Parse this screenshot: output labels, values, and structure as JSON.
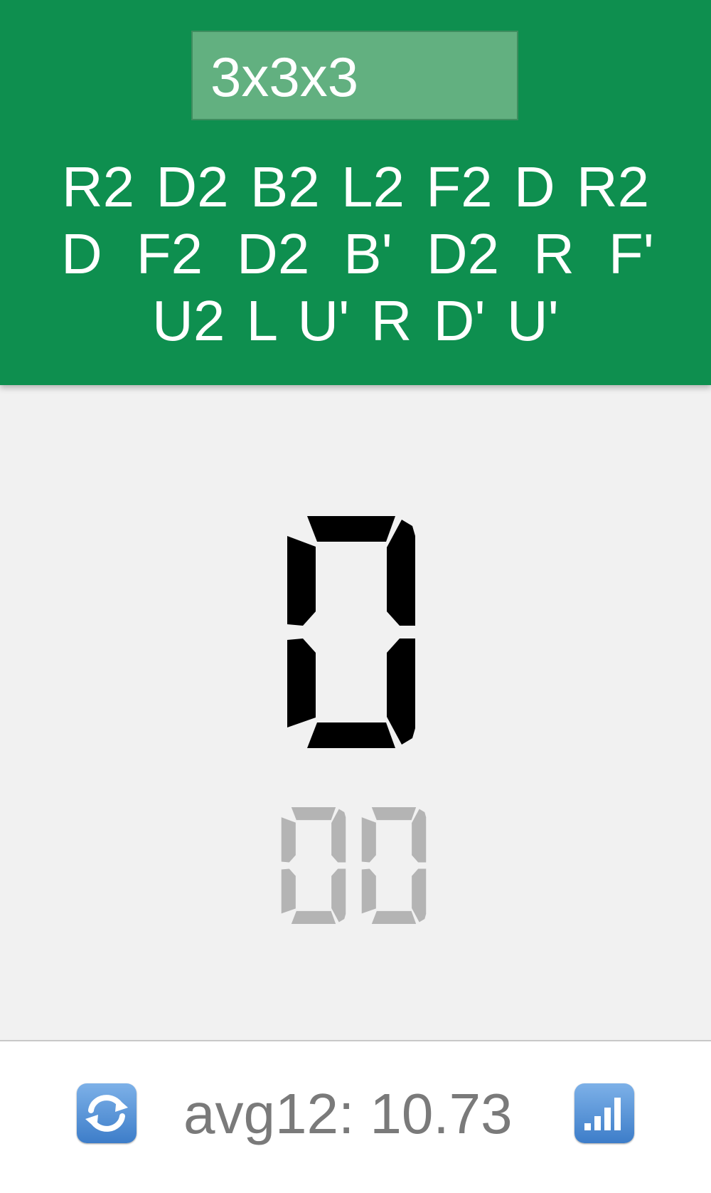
{
  "header": {
    "puzzle": "3x3x3",
    "scramble_lines": [
      [
        "R2",
        "D2",
        "B2",
        "L2",
        "F2",
        "D",
        "R2"
      ],
      [
        "D",
        "F2",
        "D2",
        "B'",
        "D2",
        "R",
        "F'"
      ],
      [
        "U2",
        "L",
        "U'",
        "R",
        "D'",
        "U'"
      ]
    ]
  },
  "timer": {
    "seconds": "0",
    "centiseconds": "00"
  },
  "footer": {
    "refresh_icon": "refresh-icon",
    "average_text": "avg12: 10.73",
    "stats_icon": "signal-bars-icon"
  },
  "colors": {
    "header": "#0e8f4f",
    "main_digit": "#000000",
    "small_digits": "#b4b4b4"
  }
}
